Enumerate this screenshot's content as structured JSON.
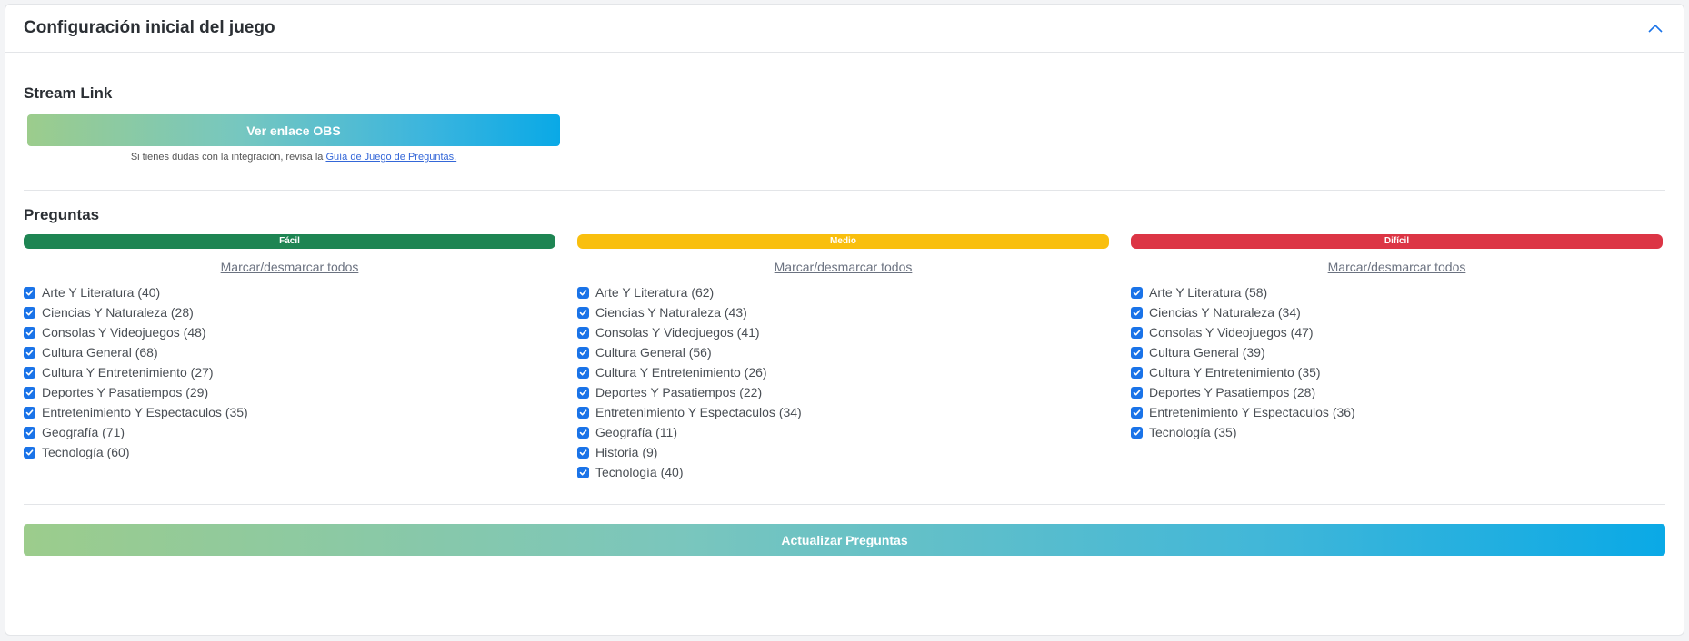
{
  "header": {
    "title": "Configuración inicial del juego",
    "collapse_icon": "chevron-up-icon"
  },
  "stream": {
    "title": "Stream Link",
    "button_label": "Ver enlace OBS",
    "help_prefix": "Si tienes dudas con la integración, revisa la ",
    "help_link": "Guía de Juego de Preguntas."
  },
  "questions": {
    "title": "Preguntas",
    "levels": [
      {
        "label": "Fácil",
        "color": "#1e8553",
        "toggle_label": "Marcar/desmarcar todos",
        "categories": [
          "Arte Y Literatura (40)",
          "Ciencias Y Naturaleza (28)",
          "Consolas Y Videojuegos (48)",
          "Cultura General (68)",
          "Cultura Y Entretenimiento (27)",
          "Deportes Y Pasatiempos (29)",
          "Entretenimiento Y Espectaculos (35)",
          "Geografía (71)",
          "Tecnología (60)"
        ]
      },
      {
        "label": "Medio",
        "color": "#f9bf0e",
        "toggle_label": "Marcar/desmarcar todos",
        "categories": [
          "Arte Y Literatura (62)",
          "Ciencias Y Naturaleza (43)",
          "Consolas Y Videojuegos (41)",
          "Cultura General (56)",
          "Cultura Y Entretenimiento (26)",
          "Deportes Y Pasatiempos (22)",
          "Entretenimiento Y Espectaculos (34)",
          "Geografía (11)",
          "Historia (9)",
          "Tecnología (40)"
        ]
      },
      {
        "label": "Difícil",
        "color": "#dc3545",
        "toggle_label": "Marcar/desmarcar todos",
        "categories": [
          "Arte Y Literatura (58)",
          "Ciencias Y Naturaleza (34)",
          "Consolas Y Videojuegos (47)",
          "Cultura General (39)",
          "Cultura Y Entretenimiento (35)",
          "Deportes Y Pasatiempos (28)",
          "Entretenimiento Y Espectaculos (36)",
          "Tecnología (35)"
        ]
      }
    ]
  },
  "footer": {
    "update_button_label": "Actualizar Preguntas"
  },
  "colors": {
    "checkbox": "#1a73e8",
    "link": "#3467d8"
  }
}
